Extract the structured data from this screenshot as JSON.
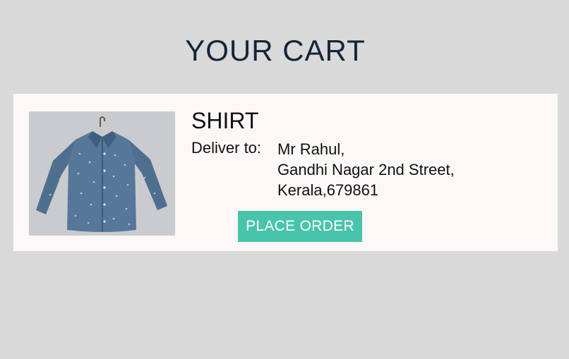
{
  "page": {
    "title": "YOUR CART",
    "background_color": "#d9d9d9"
  },
  "cart_item": {
    "name": "SHIRT",
    "image": "blue-printed-shirt-on-hanger",
    "deliver_label": "Deliver to:",
    "address_lines": [
      "Mr Rahul,",
      "Gandhi Nagar 2nd Street,",
      "Kerala,679861"
    ],
    "place_order_label": "PLACE ORDER",
    "button_color": "#48c4aa"
  }
}
